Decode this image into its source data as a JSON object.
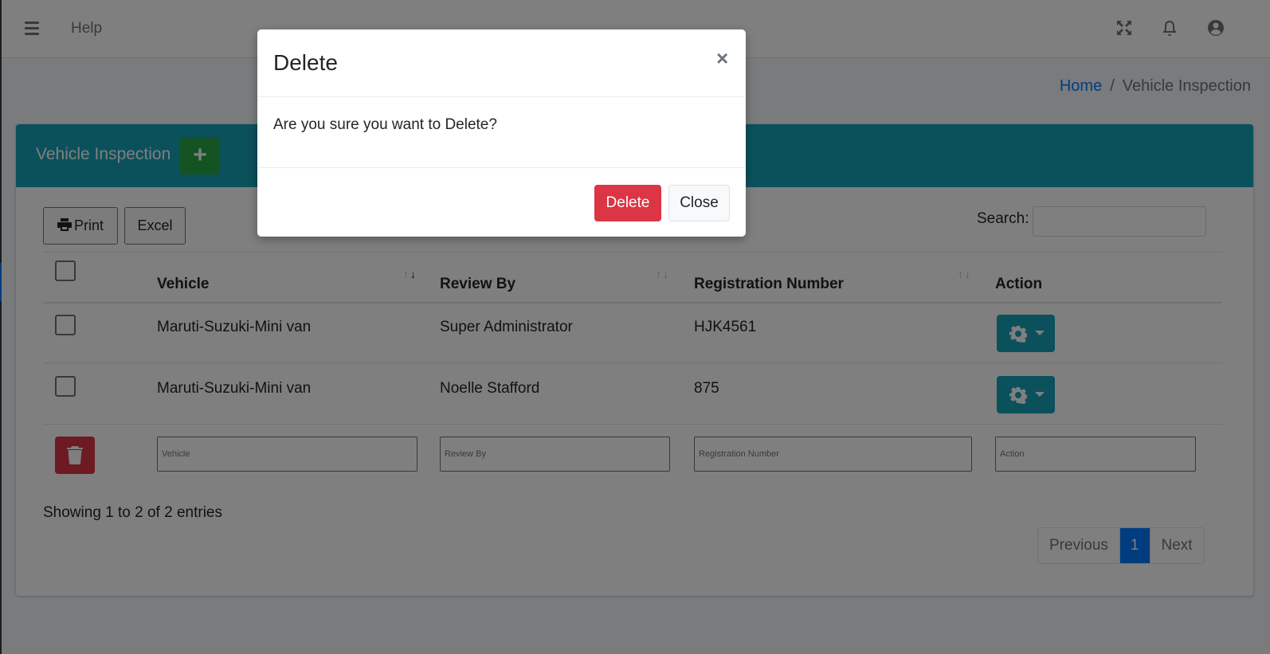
{
  "navbar": {
    "help_label": "Help"
  },
  "breadcrumb": {
    "home": "Home",
    "separator": "/",
    "current": "Vehicle Inspection"
  },
  "card": {
    "title": "Vehicle Inspection",
    "add_label": "+"
  },
  "toolbar": {
    "print_label": "Print",
    "excel_label": "Excel",
    "search_label": "Search:",
    "search_value": ""
  },
  "table": {
    "columns": [
      "Vehicle",
      "Review By",
      "Registration Number",
      "Action"
    ],
    "rows": [
      {
        "vehicle": "Maruti-Suzuki-Mini van",
        "review_by": "Super Administrator",
        "registration": "HJK4561"
      },
      {
        "vehicle": "Maruti-Suzuki-Mini van",
        "review_by": "Noelle Stafford",
        "registration": "875"
      }
    ],
    "filters": {
      "vehicle": "Vehicle",
      "review_by": "Review By",
      "registration": "Registration Number",
      "action": "Action"
    }
  },
  "footer": {
    "info": "Showing 1 to 2 of 2 entries",
    "previous": "Previous",
    "page": "1",
    "next": "Next"
  },
  "modal": {
    "title": "Delete",
    "close_symbol": "×",
    "message": "Are you sure you want to Delete?",
    "delete_label": "Delete",
    "close_label": "Close"
  },
  "colors": {
    "header_teal": "#17a2b8",
    "add_green": "#28a745",
    "danger_red": "#dc3545",
    "primary_blue": "#007bff"
  }
}
